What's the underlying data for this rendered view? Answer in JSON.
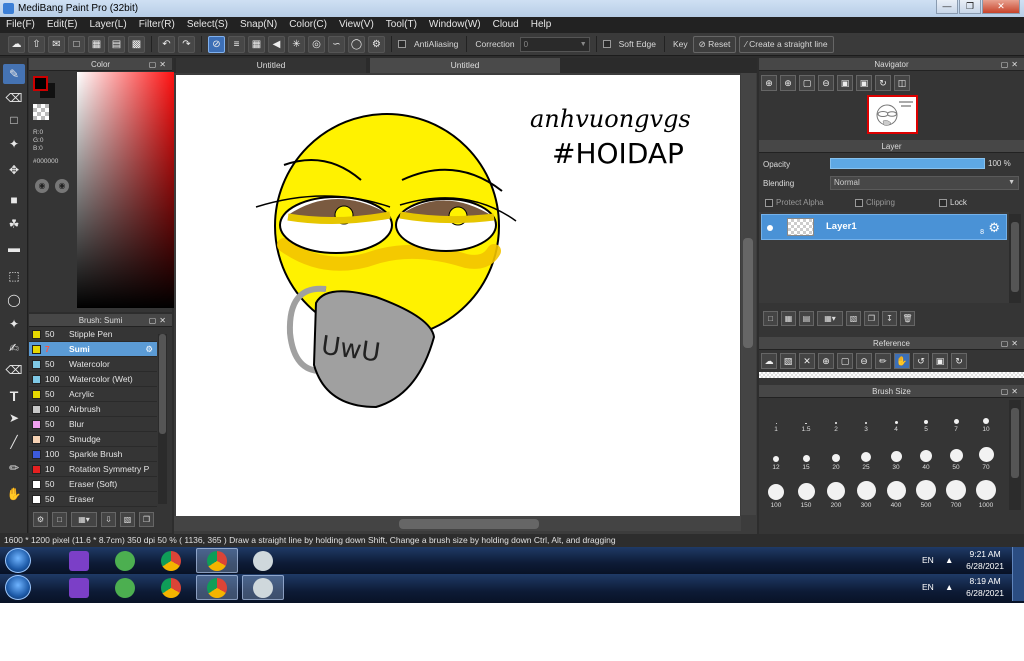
{
  "window": {
    "title": "MediBang Paint Pro (32bit)"
  },
  "menu": [
    "File(F)",
    "Edit(E)",
    "Layer(L)",
    "Filter(R)",
    "Select(S)",
    "Snap(N)",
    "Color(C)",
    "View(V)",
    "Tool(T)",
    "Window(W)",
    "Cloud",
    "Help"
  ],
  "toolbar": {
    "antialiasing": "AntiAliasing",
    "correction_label": "Correction",
    "correction_value": "0",
    "soft_edge": "Soft Edge",
    "key": "Key",
    "reset": "Reset",
    "straight_line": "Create a straight line"
  },
  "color_panel": {
    "title": "Color",
    "r": "R:0",
    "g": "G:0",
    "b": "B:0",
    "hex": "#000000",
    "fg_color": "#000000"
  },
  "brush_panel": {
    "title": "Brush: Sumi",
    "brushes": [
      {
        "size": "50",
        "name": "Stipple Pen",
        "color": "#e6d800"
      },
      {
        "size": "7",
        "name": "Sumi",
        "color": "#e6d800",
        "selected": true
      },
      {
        "size": "50",
        "name": "Watercolor",
        "color": "#7fc9e6"
      },
      {
        "size": "100",
        "name": "Watercolor (Wet)",
        "color": "#7fc9e6"
      },
      {
        "size": "50",
        "name": "Acrylic",
        "color": "#e6d800"
      },
      {
        "size": "100",
        "name": "Airbrush",
        "color": "#c8c8c8"
      },
      {
        "size": "50",
        "name": "Blur",
        "color": "#f0a0f0"
      },
      {
        "size": "70",
        "name": "Smudge",
        "color": "#f6d2b4"
      },
      {
        "size": "100",
        "name": "Sparkle Brush",
        "color": "#3c5adc"
      },
      {
        "size": "10",
        "name": "Rotation Symmetry P",
        "color": "#e62020"
      },
      {
        "size": "50",
        "name": "Eraser (Soft)",
        "color": "#ffffff"
      },
      {
        "size": "50",
        "name": "Eraser",
        "color": "#ffffff"
      }
    ]
  },
  "tabs": [
    "Untitled",
    "Untitled"
  ],
  "canvas": {
    "handwriting_1": "anhvuongvgs",
    "handwriting_2": "#HOIDAP",
    "mug_text": "UwU"
  },
  "navigator": {
    "title": "Navigator"
  },
  "layer_panel": {
    "title": "Layer",
    "opacity_label": "Opacity",
    "opacity_value": "100 %",
    "opacity_fraction": 1.0,
    "blending_label": "Blending",
    "blending_value": "Normal",
    "protect_alpha": "Protect Alpha",
    "clipping": "Clipping",
    "lock": "Lock",
    "layer_name": "Layer1",
    "layer_badge": "8"
  },
  "reference_panel": {
    "title": "Reference"
  },
  "brush_size_panel": {
    "title": "Brush Size",
    "sizes": [
      "1",
      "1.5",
      "2",
      "3",
      "4",
      "5",
      "7",
      "10",
      "12",
      "15",
      "20",
      "25",
      "30",
      "40",
      "50",
      "70",
      "100",
      "150",
      "200",
      "300",
      "400",
      "500",
      "700",
      "1000"
    ]
  },
  "status": {
    "text": "1600 * 1200 pixel   (11.6 * 8.7cm)   350 dpi   50 %   ( 1136, 365 )   Draw a straight line by holding down Shift, Change a brush size by holding down Ctrl, Alt, and dragging"
  },
  "taskbars": [
    {
      "lang": "EN",
      "time": "9:21 AM",
      "date": "6/28/2021"
    },
    {
      "lang": "EN",
      "time": "8:19 AM",
      "date": "6/28/2021"
    }
  ]
}
